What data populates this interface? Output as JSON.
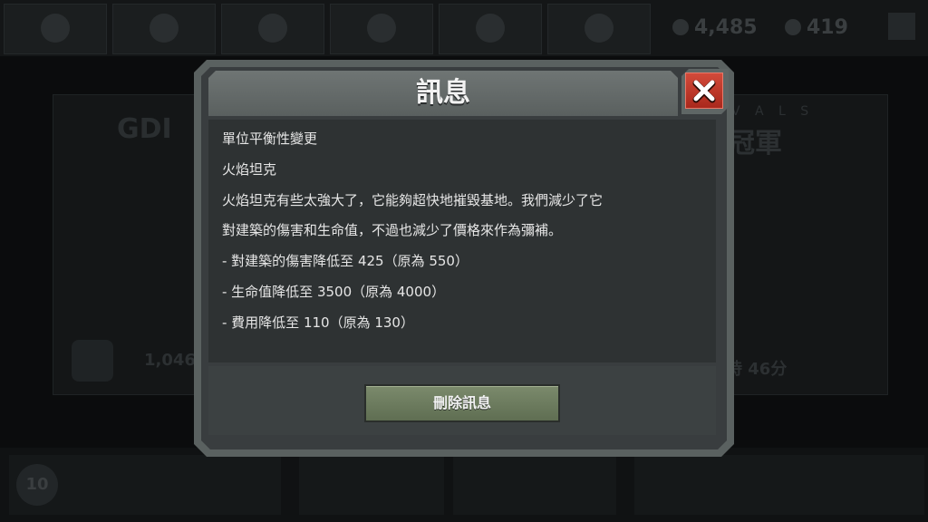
{
  "dialog": {
    "title": "訊息",
    "lines": [
      "單位平衡性變更",
      "火焰坦克",
      "火焰坦克有些太強大了，它能夠超快地摧毀基地。我們減少了它",
      "對建築的傷害和生命值，不過也減少了價格來作為彌補。",
      "- 對建築的傷害降低至 425（原為 550）",
      "- 生命值降低至 3500（原為 4000）",
      "- 費用降低至 110（原為 130）"
    ],
    "close_icon": "close-x-icon",
    "delete_button_label": "刪除訊息"
  },
  "background": {
    "resource_1": "4,485",
    "resource_2": "419",
    "left_panel_number": "1,046",
    "right_panel_label": "V A L S",
    "right_panel_title": "冠軍",
    "right_panel_timer": "時 46分",
    "player_level": "10"
  },
  "colors": {
    "close_button": "#c0392b",
    "delete_button": "#6f7e5f",
    "dialog_frame": "#5a6160",
    "dialog_content": "#2e3233"
  }
}
